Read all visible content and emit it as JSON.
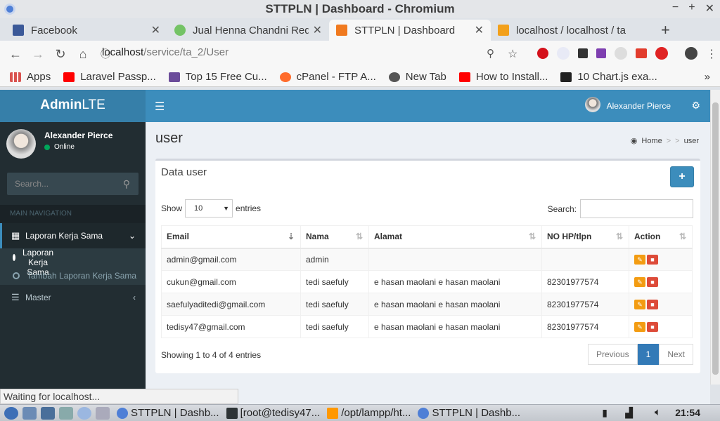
{
  "window": {
    "title": "STTPLN | Dashboard - Chromium"
  },
  "tabs": [
    {
      "label": "Facebook",
      "color": "#3b5998"
    },
    {
      "label": "Jual Henna Chandni Red",
      "color": "#74c365"
    },
    {
      "label": "STTPLN | Dashboard",
      "color": "#f0791e"
    },
    {
      "label": "localhost / localhost / ta",
      "color": "#f2a01b"
    }
  ],
  "address": {
    "host": "localhost",
    "path": "/service/ta_2/User"
  },
  "bookmarks": [
    {
      "label": "Apps",
      "color": "#d9534f"
    },
    {
      "label": "Laravel Passp...",
      "color": "#ff0000"
    },
    {
      "label": "Top 15 Free Cu...",
      "color": "#6b4c9a"
    },
    {
      "label": "cPanel - FTP A...",
      "color": "#ff6c2c"
    },
    {
      "label": "New Tab",
      "color": "#555555"
    },
    {
      "label": "How to Install...",
      "color": "#ff0000"
    },
    {
      "label": "10 Chart.js exa...",
      "color": "#222222"
    }
  ],
  "app": {
    "brand_bold": "Admin",
    "brand_light": "LTE",
    "user_name": "Alexander Pierce",
    "user_status": "Online",
    "search_placeholder": "Search...",
    "nav_header": "MAIN NAVIGATION",
    "menu": {
      "laporan": "Laporan Kerja Sama",
      "list": "List Laporan Kerja Sama",
      "tambah": "Tambah Laporan Kerja Sama",
      "master": "Master"
    }
  },
  "content": {
    "title": "user",
    "breadcrumb": {
      "home": "Home",
      "current": "user"
    },
    "box_title": "Data user",
    "show_label": "Show",
    "show_value": "10",
    "entries_label": "entries",
    "search_label": "Search:",
    "columns": [
      "Email",
      "Nama",
      "Alamat",
      "NO HP/tlpn",
      "Action"
    ],
    "rows": [
      {
        "email": "admin@gmail.com",
        "nama": "admin",
        "alamat": "",
        "hp": ""
      },
      {
        "email": "cukun@gmail.com",
        "nama": "tedi saefuly",
        "alamat": "e hasan maolani e hasan maolani",
        "hp": "82301977574"
      },
      {
        "email": "saefulyaditedi@gmail.com",
        "nama": "tedi saefuly",
        "alamat": "e hasan maolani e hasan maolani",
        "hp": "82301977574"
      },
      {
        "email": "tedisy47@gmail.com",
        "nama": "tedi saefuly",
        "alamat": "e hasan maolani e hasan maolani",
        "hp": "82301977574"
      }
    ],
    "info": "Showing 1 to 4 of 4 entries",
    "pager": {
      "prev": "Previous",
      "page": "1",
      "next": "Next"
    }
  },
  "status_text": "Waiting for localhost...",
  "taskbar": {
    "tasks": [
      "STTPLN | Dashb...",
      "[root@tedisy47...",
      "/opt/lampp/ht...",
      "STTPLN | Dashb..."
    ],
    "clock": "21:54"
  }
}
